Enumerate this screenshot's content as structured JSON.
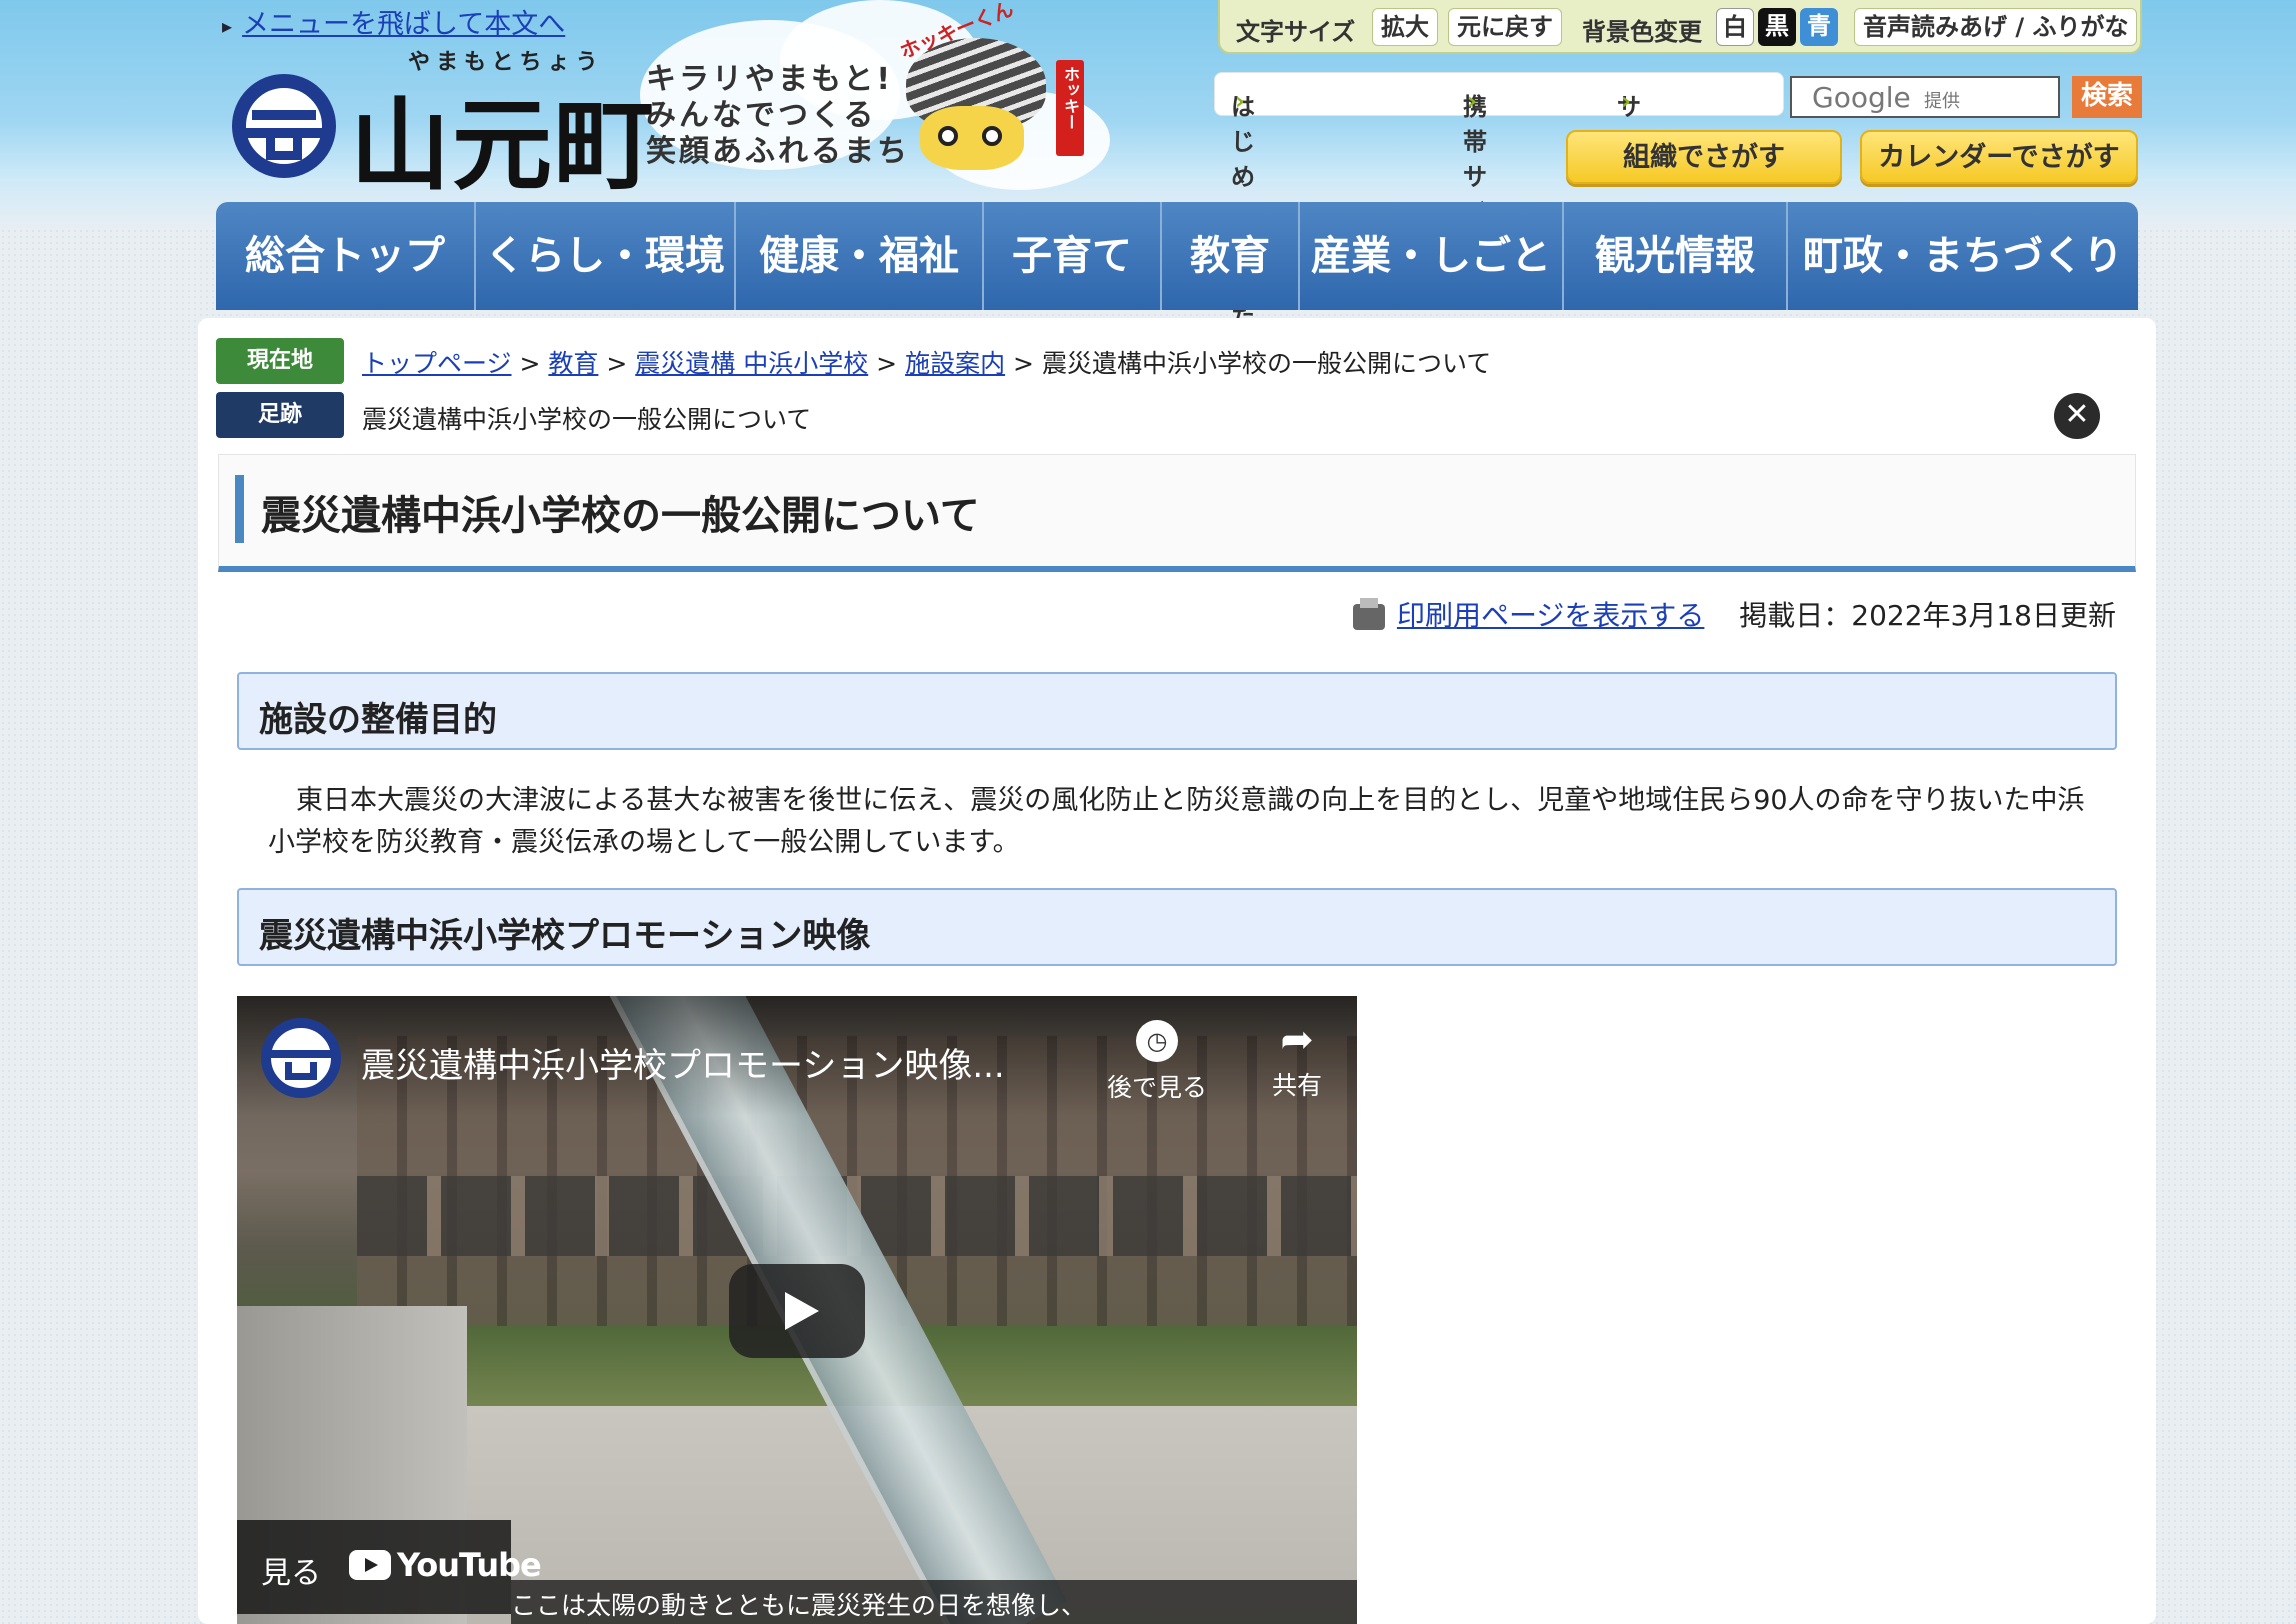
{
  "header": {
    "skip_link": "メニューを飛ばして本文へ",
    "logo_ruby": "やまもとちょう",
    "logo_name": "山元町",
    "slogan": [
      "キラリやまもと!",
      "みんなでつくる",
      "笑顔あふれるまち"
    ],
    "mascot_name": "ホッキーくん",
    "mascot_flag": "ホッキー"
  },
  "toolbar": {
    "font_size_label": "文字サイズ",
    "enlarge": "拡大",
    "reset": "元に戻す",
    "bgcolor_label": "背景色変更",
    "white": "白",
    "black": "黒",
    "blue": "青",
    "speech": "音声読みあげ / ふりがな"
  },
  "links": {
    "beginner": "はじめてのかたへ",
    "mobile": "携帯サイト",
    "sitemap": "サイトマップ"
  },
  "search": {
    "google": "Google",
    "provided": "提供",
    "button": "検索"
  },
  "quick": {
    "org": "組織でさがす",
    "calendar": "カレンダーでさがす"
  },
  "nav": [
    "総合トップ",
    "くらし・環境",
    "健康・福祉",
    "子育て",
    "教育",
    "産業・しごと",
    "観光情報",
    "町政・まちづくり"
  ],
  "breadcrumb": {
    "current_label": "現在地",
    "items": [
      "トップページ",
      "教育",
      "震災遺構 中浜小学校",
      "施設案内"
    ],
    "sep": ">",
    "current": "震災遺構中浜小学校の一般公開について",
    "trail_label": "足跡",
    "trail": "震災遺構中浜小学校の一般公開について"
  },
  "page": {
    "title": "震災遺構中浜小学校の一般公開について",
    "print_link": "印刷用ページを表示する",
    "updated": "掲載日：2022年3月18日更新",
    "section1": "施設の整備目的",
    "paragraph": "東日本大震災の大津波による甚大な被害を後世に伝え、震災の風化防止と防災意識の向上を目的とし、児童や地域住民ら90人の命を守り抜いた中浜小学校を防災教育・震災伝承の場として一般公開しています。",
    "section2": "震災遺構中浜小学校プロモーション映像"
  },
  "video": {
    "title": "震災遺構中浜小学校プロモーション映像...",
    "watch_later": "後で見る",
    "share": "共有",
    "watch_on": "見る",
    "youtube": "YouTube",
    "caption": "ここは太陽の動きとともに震災発生の日を想像し、"
  },
  "colors": {
    "nav_blue": "#2f67ad",
    "link": "#1b3fb6",
    "green_tag": "#3d8b3a",
    "navy_tag": "#203a66"
  }
}
